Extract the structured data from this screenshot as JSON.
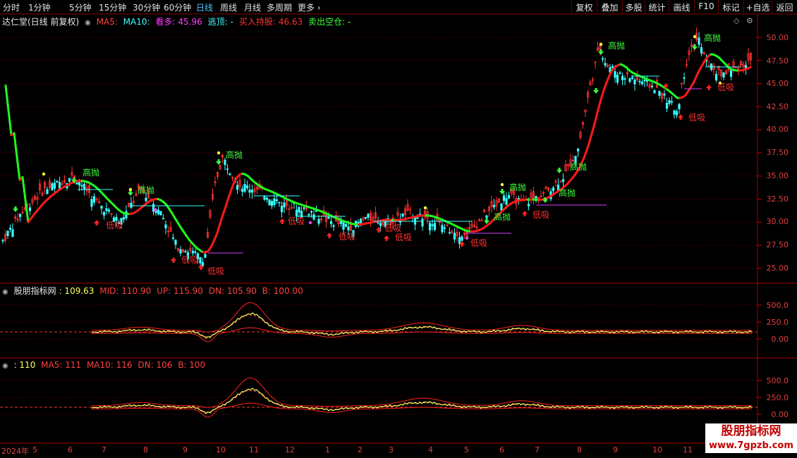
{
  "toolbar": {
    "periods": [
      "分时",
      "1分钟",
      "5分钟",
      "15分钟",
      "30分钟",
      "60分钟",
      "日线",
      "周线",
      "月线",
      "多周期",
      "更多 ›"
    ],
    "active_period": "日线",
    "right_buttons": [
      "复权",
      "叠加",
      "多股",
      "统计",
      "画线",
      "F10",
      "标记",
      "+自选",
      "返回"
    ]
  },
  "main_panel": {
    "title": "达仁堂(日线 前复权)",
    "legend": {
      "ma5": "MA5:",
      "ma10": "MA10:",
      "bullish_label": "看多:",
      "bullish_value": "45.96",
      "escape_label": "逃顶:",
      "escape_value": "-",
      "buy_label": "买入持股:",
      "buy_value": "46.63",
      "sell_label": "卖出空仓:",
      "sell_value": "-"
    },
    "y_ticks": [
      "50.00",
      "47.50",
      "45.00",
      "42.50",
      "40.00",
      "37.50",
      "35.00",
      "32.50",
      "30.00",
      "27.50",
      "25.00"
    ],
    "high_label": "高抛",
    "low_label": "低吸"
  },
  "indicator_panel_1": {
    "title": "股朋指标网",
    "value": ": 109.63",
    "mid": "MID: 110.90",
    "up": "UP: 115.90",
    "dn": "DN: 105.90",
    "b": "B: 100.00",
    "y_ticks": [
      "500.0",
      "250.0",
      "0.00"
    ]
  },
  "indicator_panel_2": {
    "value": ": 110",
    "ma5": "MA5: 111",
    "ma10": "MA10: 116",
    "dn": "DN: 106",
    "b": "B: 100",
    "y_ticks": [
      "500.0",
      "250.0",
      "0.00"
    ]
  },
  "date_axis": [
    "2024年",
    "5",
    "6",
    "7",
    "8",
    "9",
    "10",
    "11",
    "12",
    "1",
    "2",
    "3",
    "4",
    "5",
    "6",
    "7",
    "8",
    "9",
    "10",
    "11"
  ],
  "watermark": {
    "line1": "股朋指标网",
    "line2": "www.7gpzb.com"
  },
  "colors": {
    "up": "#ff3030",
    "down": "#3cffff",
    "ma_up": "#ff1a1a",
    "ma_down": "#1eff1e",
    "grid": "#7a0000"
  }
}
